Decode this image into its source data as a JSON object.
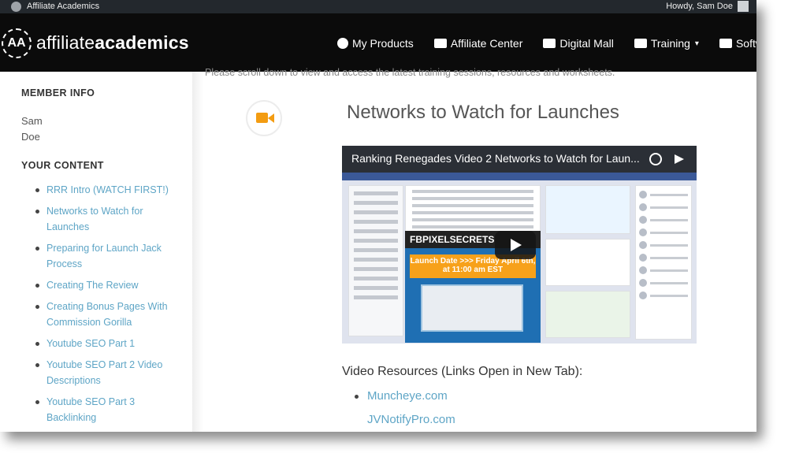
{
  "adminbar": {
    "site_name": "Affiliate Academics",
    "greeting": "Howdy, Sam Doe"
  },
  "header": {
    "logo_mark": "AA",
    "logo_light": "affiliate",
    "logo_bold": "academics",
    "nav": [
      {
        "label": "My Products",
        "icon": "dashboard-icon"
      },
      {
        "label": "Affiliate Center",
        "icon": "ticket-icon"
      },
      {
        "label": "Digital Mall",
        "icon": "binoculars-icon"
      },
      {
        "label": "Training",
        "icon": "graduation-cap-icon",
        "has_dropdown": true
      },
      {
        "label": "Software",
        "icon": "puzzle-icon"
      }
    ]
  },
  "sidebar": {
    "member_heading": "MEMBER INFO",
    "first_name": "Sam",
    "last_name": "Doe",
    "content_heading": "YOUR CONTENT",
    "lessons": [
      "RRR Intro (WATCH FIRST!)",
      "Networks to Watch for Launches",
      "Preparing for Launch Jack Process",
      "Creating The Review",
      "Creating Bonus Pages With Commission Gorilla",
      "Youtube SEO Part 1",
      "Youtube SEO Part 2 Video Descriptions",
      "Youtube SEO Part 3 Backlinking"
    ]
  },
  "main": {
    "intro_text": "Please scroll down to view and access the latest training sessions, resources and worksheets.",
    "lesson_title": "Networks to Watch for Launches",
    "video": {
      "title": "Ranking Renegades Video 2 Networks to Watch for Laun...",
      "promo_heading": "FBPIXELSECRETS",
      "promo_date": "Launch Date >>> Friday April 6th, at 11:00 am EST"
    },
    "resources_heading": "Video Resources (Links Open in New Tab):",
    "resources": [
      "Muncheye.com",
      "JVNotifyPro.com"
    ]
  },
  "colors": {
    "accent_orange": "#f39c12",
    "link_blue": "#5ea5c6",
    "header_bg": "#0b0b0b"
  }
}
